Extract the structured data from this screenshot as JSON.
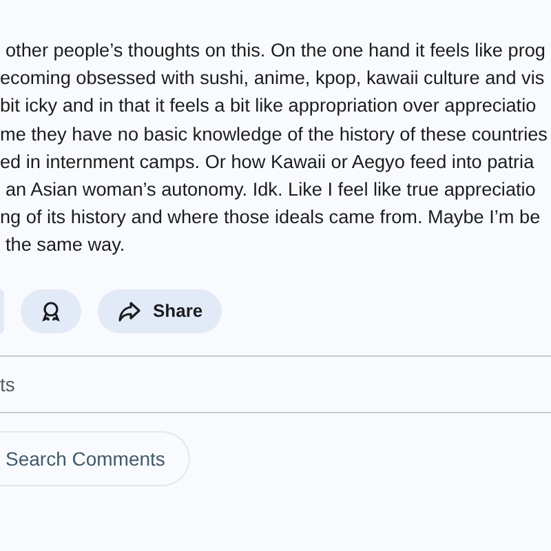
{
  "post": {
    "lines": [
      "other people’s thoughts on this. On the one hand it feels like prog",
      "ecoming obsessed with sushi, anime, kpop, kawaii culture and vis",
      "bit icky and in that it feels a bit like appropriation over appreciatio",
      "me they have no basic knowledge of the history of these countries",
      "ed in internment camps. Or how Kawaii or Aegyo feed into patria",
      "an Asian woman’s autonomy. Idk. Like I feel like true appreciatio",
      "ng of its history and where those ideals came from. Maybe I’m be",
      "the same way."
    ]
  },
  "actions": {
    "share": "Share"
  },
  "comments_header": "ts",
  "search_comments": {
    "placeholder": "Search Comments"
  }
}
